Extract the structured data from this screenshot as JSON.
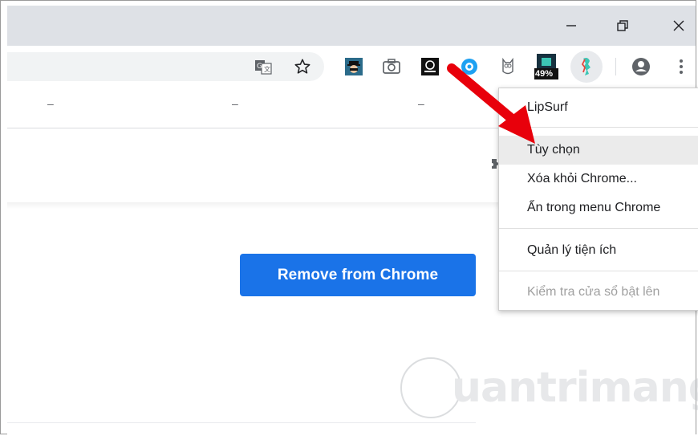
{
  "window_controls": {
    "minimize_label": "minimize",
    "restore_label": "restore",
    "close_label": "close"
  },
  "toolbar": {
    "battery_percent": "49%"
  },
  "bookmarks_row": {
    "placeholders": [
      "–",
      "–",
      "–"
    ]
  },
  "page": {
    "remove_button_label": "Remove from Chrome"
  },
  "context_menu": {
    "title": "LipSurf",
    "items": [
      {
        "label": "Tùy chọn",
        "state": "hover"
      },
      {
        "label": "Xóa khỏi Chrome...",
        "state": "normal"
      },
      {
        "label": "Ẩn trong menu Chrome",
        "state": "normal"
      },
      {
        "label": "Quản lý tiện ích",
        "state": "normal"
      },
      {
        "label": "Kiểm tra cửa sổ bật lên",
        "state": "disabled"
      }
    ]
  },
  "watermark": {
    "text": "uantrimang"
  },
  "colors": {
    "accent_blue": "#1a73e8",
    "arrow_red": "#e8000b",
    "titlebar": "#dee1e6"
  }
}
